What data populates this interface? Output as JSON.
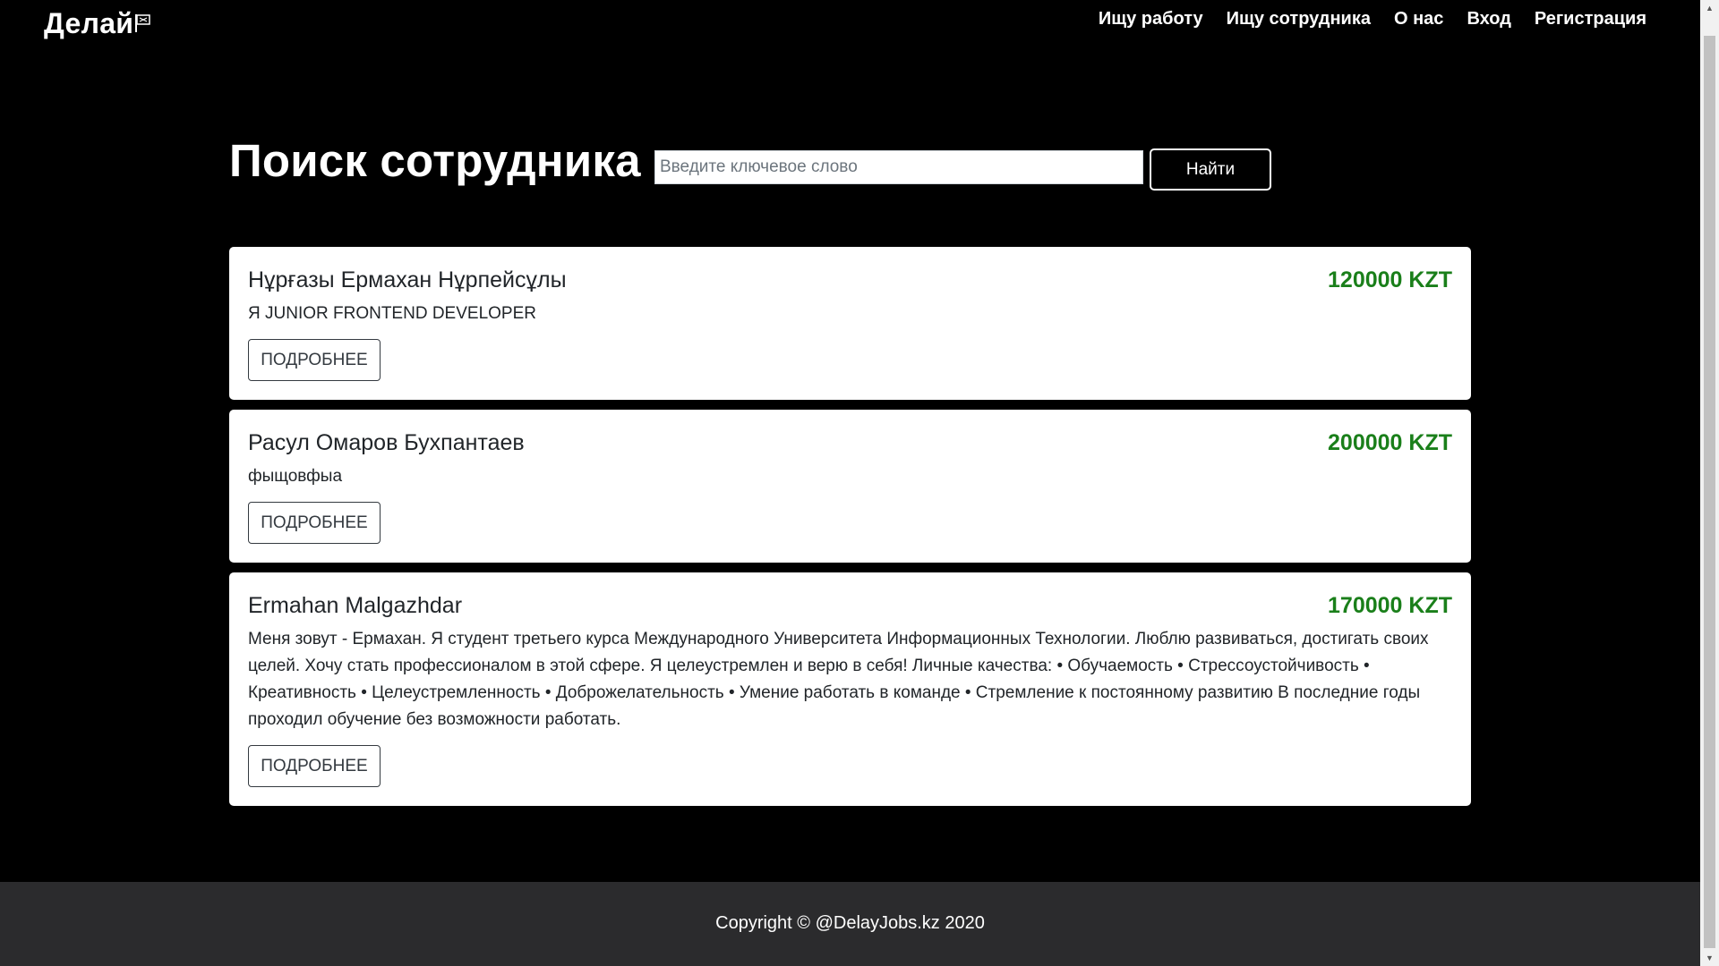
{
  "brand": {
    "name": "Делай",
    "icon": "flag-icon"
  },
  "nav": {
    "items": [
      {
        "label": "Ищу работу"
      },
      {
        "label": "Ищу сотрудника"
      },
      {
        "label": "О нас"
      },
      {
        "label": "Вход"
      },
      {
        "label": "Регистрация"
      }
    ]
  },
  "search": {
    "title": "Поиск сотрудника",
    "placeholder": "Введите ключевое слово",
    "value": "",
    "button_label": "Найти"
  },
  "cards": [
    {
      "name": "Нұрғазы Ермахан Нұрпейсұлы",
      "salary": "120000 KZT",
      "description": "Я JUNIOR FRONTEND DEVELOPER",
      "button_label": "ПОДРОБНЕЕ"
    },
    {
      "name": "Расул Омаров Бухпантаев",
      "salary": "200000 KZT",
      "description": "фыщовфыа",
      "button_label": "ПОДРОБНЕЕ"
    },
    {
      "name": "Ermahan Malgazhdar",
      "salary": "170000 KZT",
      "description": "Меня зовут - Ермахан. Я студент третьего курса Международного Университета Информационных Технологии. Люблю развиваться, достигать своих целей. Хочу стать профессионалом в этой сфере. Я целеустремлен и верю в себя! Личные качества: • Обучаемость • Стрессоустойчивость • Креативность • Целеустремленность • Доброжелательность • Умение работать в команде • Стремление к постоянному развитию В последние годы проходил обучение без возможности работать.",
      "button_label": "ПОДРОБНЕЕ"
    }
  ],
  "footer": {
    "text": "Copyright © @DelayJobs.kz 2020"
  },
  "colors": {
    "background": "#000000",
    "salary": "#1a7f1a",
    "footer": "#2b2b2d"
  }
}
